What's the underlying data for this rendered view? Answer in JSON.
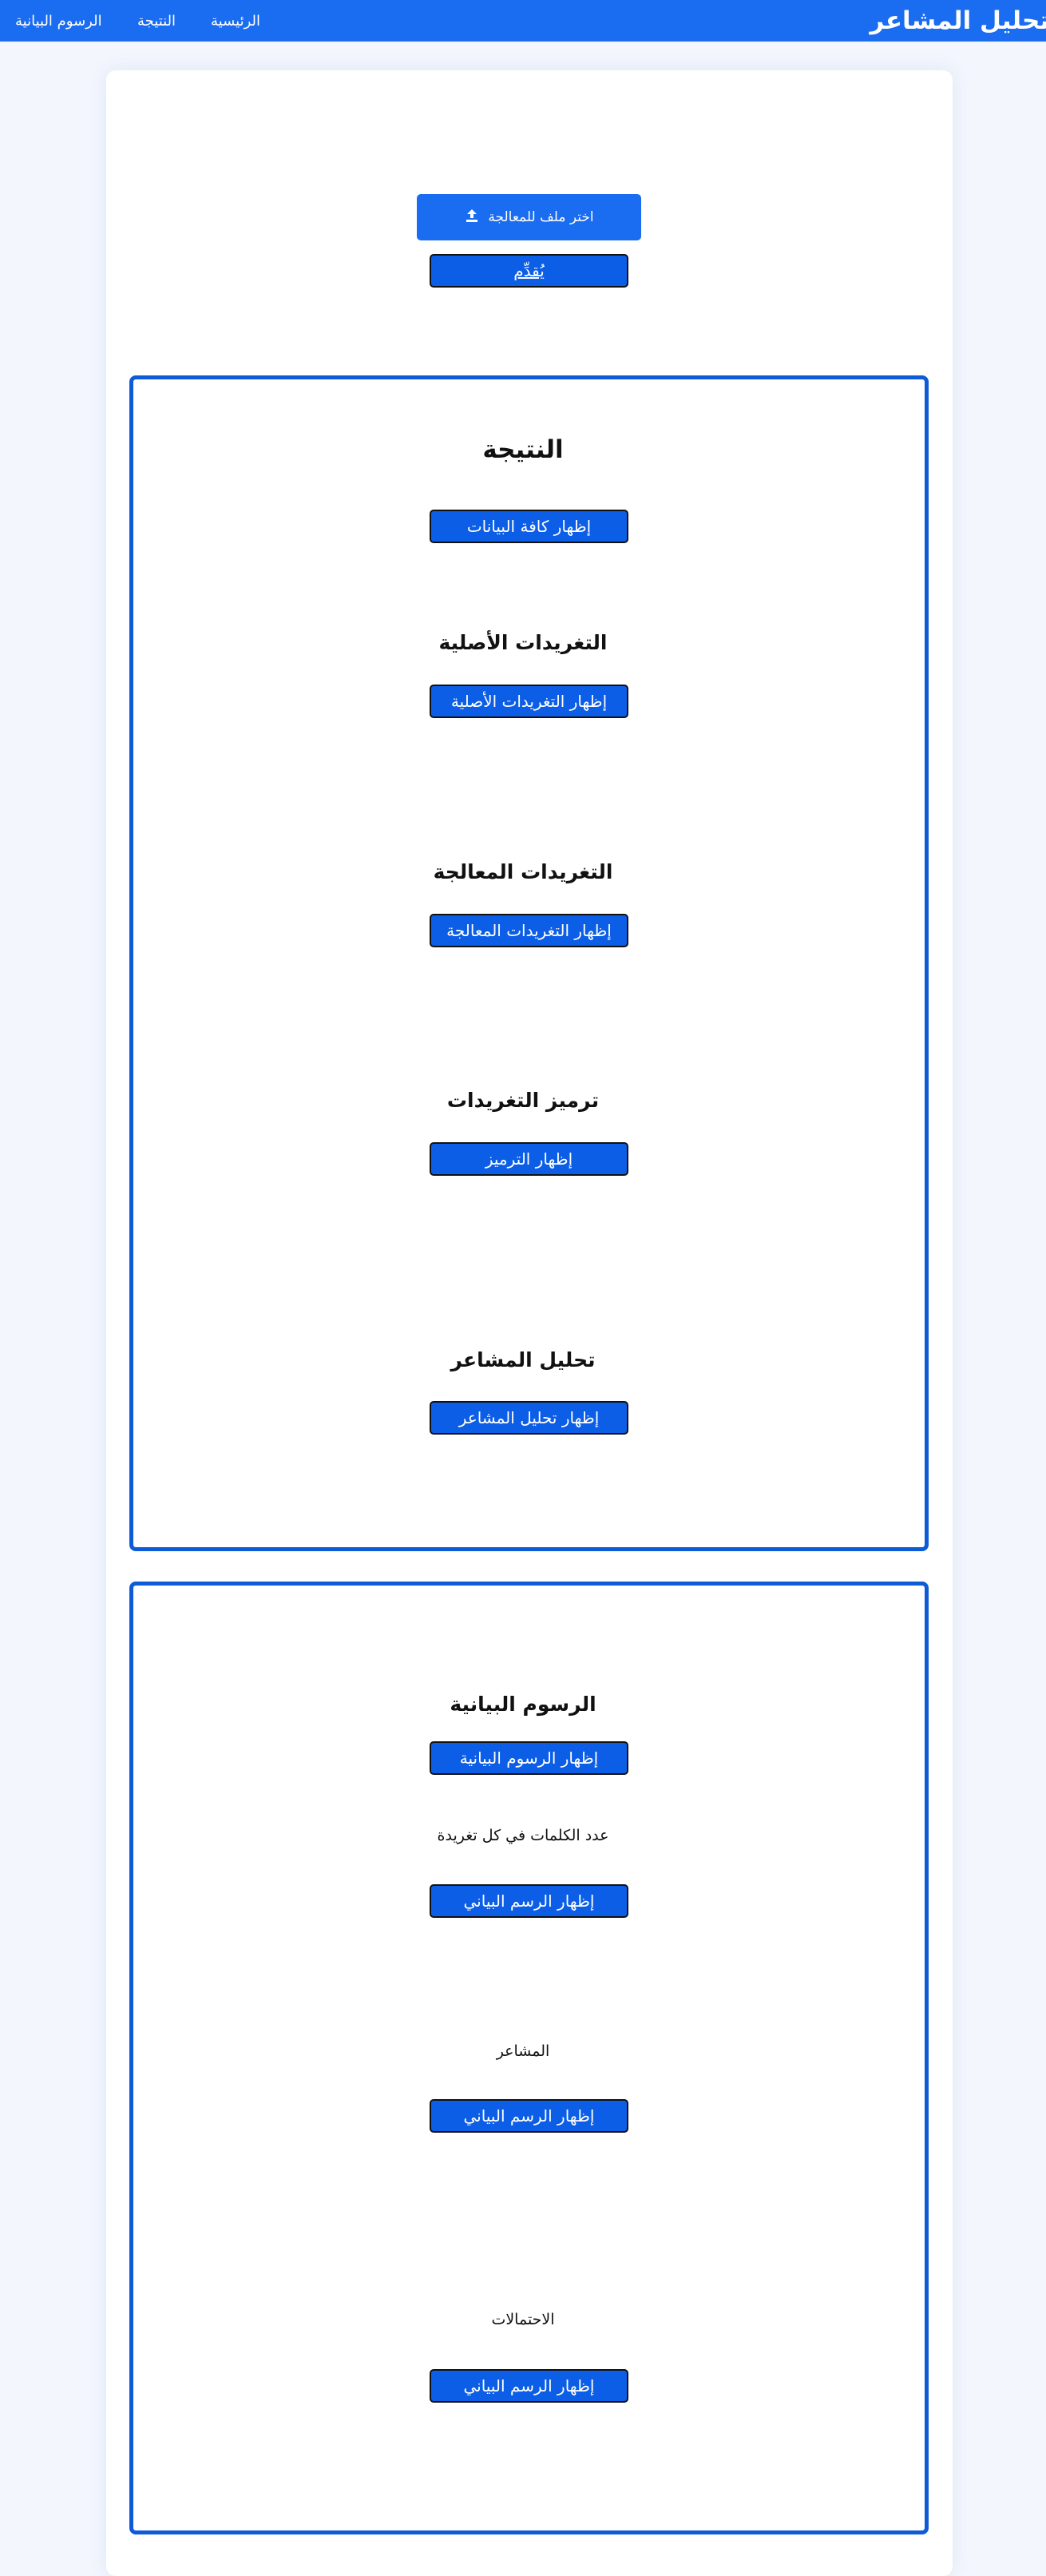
{
  "navbar": {
    "brand": "تحليل المشاعر",
    "links": [
      "الرئيسية",
      "النتيجة",
      "الرسوم البيانية"
    ]
  },
  "upload": {
    "button_label": "اختر ملف للمعالجة",
    "icon": "upload-icon",
    "submit_label": "يُقدِّم"
  },
  "results": {
    "title": "النتيجة",
    "show_all_label": "إظهار كافة البيانات",
    "original_tweets": {
      "heading": "التغريدات الأصلية",
      "button_label": "إظهار التغريدات الأصلية"
    },
    "processed_tweets": {
      "heading": "التغريدات المعالجة",
      "button_label": "إظهار التغريدات المعالجة"
    },
    "tweet_encoding": {
      "heading": "ترميز التغريدات",
      "button_label": "إظهار الترميز"
    },
    "sentiment_analysis": {
      "heading": "تحليل المشاعر",
      "button_label": "إظهار تحليل المشاعر"
    }
  },
  "charts": {
    "title": "الرسوم البيانية",
    "show_all_label": "إظهار الرسوم البيانية",
    "words_per_tweet": {
      "heading": "عدد الكلمات في كل تغريدة",
      "button_label": "إظهار الرسم البياني"
    },
    "sentiments": {
      "heading": "المشاعر",
      "button_label": "إظهار الرسم البياني"
    },
    "probabilities": {
      "heading": "الاحتمالات",
      "button_label": "إظهار الرسم البياني"
    }
  },
  "colors": {
    "primary": "#1a6cf0",
    "button": "#0c5ee6",
    "section_border": "#0d5bd6",
    "page_background": "#f3f6fd"
  }
}
